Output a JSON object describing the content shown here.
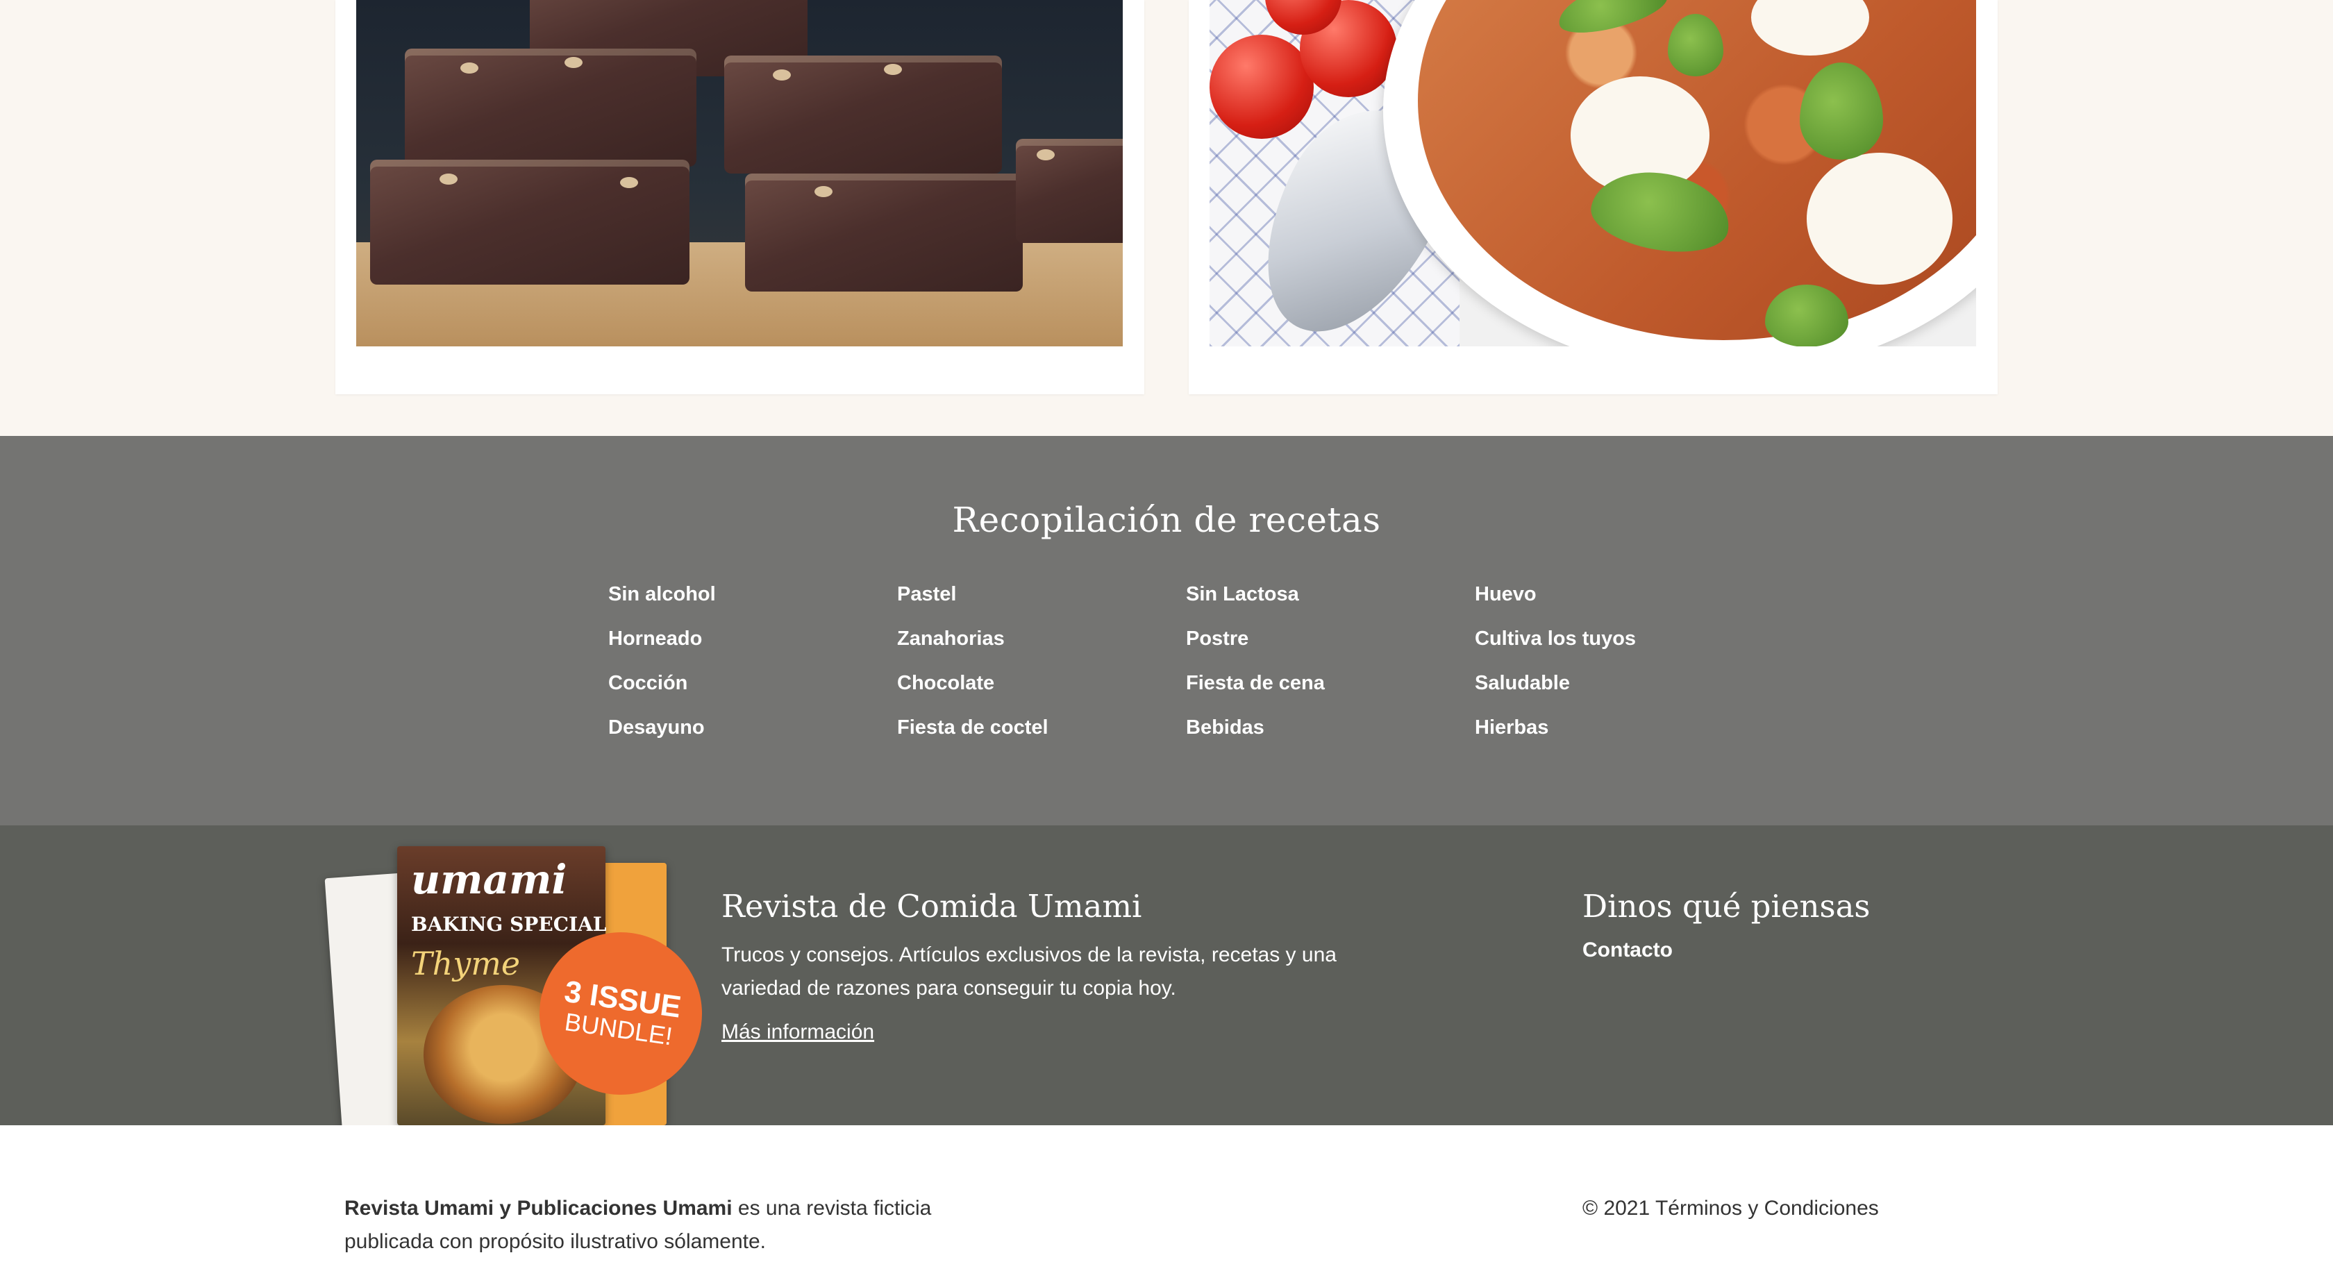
{
  "recipes_collection": {
    "title": "Recopilación de recetas",
    "columns": [
      [
        "Sin alcohol",
        "Horneado",
        "Cocción",
        "Desayuno"
      ],
      [
        "Pastel",
        "Zanahorias",
        "Chocolate",
        "Fiesta de coctel"
      ],
      [
        "Sin Lactosa",
        "Postre",
        "Fiesta de cena",
        "Bebidas"
      ],
      [
        "Huevo",
        "Cultiva los tuyos",
        "Saludable",
        "Hierbas"
      ]
    ]
  },
  "magazine": {
    "cover_logo": "umami",
    "cover_line1": "BAKING SPECIAL",
    "cover_line2": "Thyme",
    "badge_line1": "3 ISSUE",
    "badge_line2": "BUNDLE!",
    "title": "Revista de Comida Umami",
    "description": "Trucos y consejos. Artículos exclusivos de la revista, recetas y una variedad de razones para conseguir tu copia hoy.",
    "link": "Más información"
  },
  "feedback": {
    "title": "Dinos qué piensas",
    "link": "Contacto"
  },
  "footer": {
    "about_bold": "Revista Umami y Publicaciones Umami",
    "about_rest": " es una revista ficticia publicada con propósito ilustrativo sólamente.",
    "legal": "© 2021 Términos y Condiciones"
  }
}
